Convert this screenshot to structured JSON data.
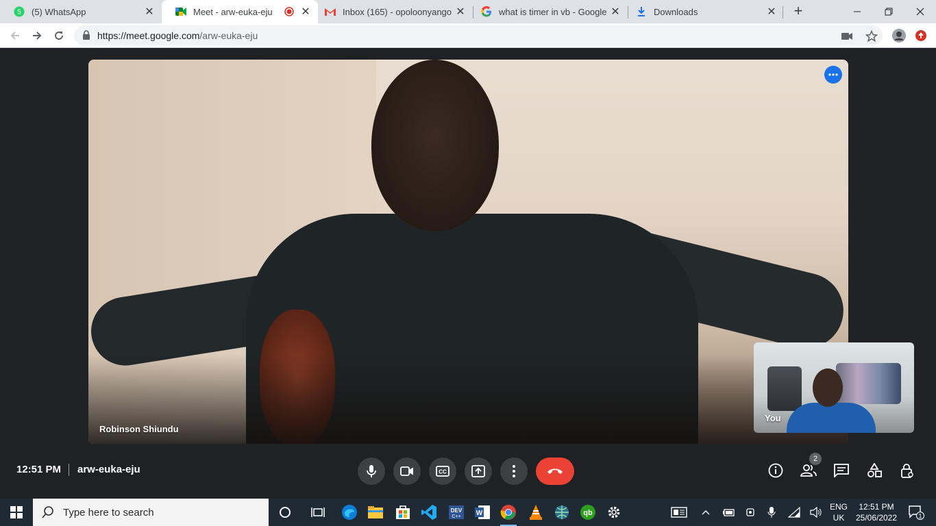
{
  "browser": {
    "tabs": [
      {
        "title": "(5) WhatsApp",
        "favicon": "whatsapp-icon",
        "badge": "5"
      },
      {
        "title": "Meet - arw-euka-eju",
        "favicon": "meet-icon",
        "recording": true
      },
      {
        "title": "Inbox (165) - opoloonyango",
        "favicon": "gmail-icon"
      },
      {
        "title": "what is timer in vb - Google",
        "favicon": "google-icon"
      },
      {
        "title": "Downloads",
        "favicon": "download-icon"
      }
    ],
    "url_host": "https://meet.google.com",
    "url_path": "/arw-euka-eju"
  },
  "meet": {
    "main_participant": "Robinson Shiundu",
    "self_label": "You",
    "time": "12:51 PM",
    "meeting_code": "arw-euka-eju",
    "participant_count": "2",
    "accent_end_call": "#ea4335",
    "accent_more": "#1a73e8"
  },
  "taskbar": {
    "search_placeholder": "Type here to search",
    "lang_top": "ENG",
    "lang_bottom": "UK",
    "clock_time": "12:51 PM",
    "clock_date": "25/06/2022",
    "notification_count": "1"
  }
}
